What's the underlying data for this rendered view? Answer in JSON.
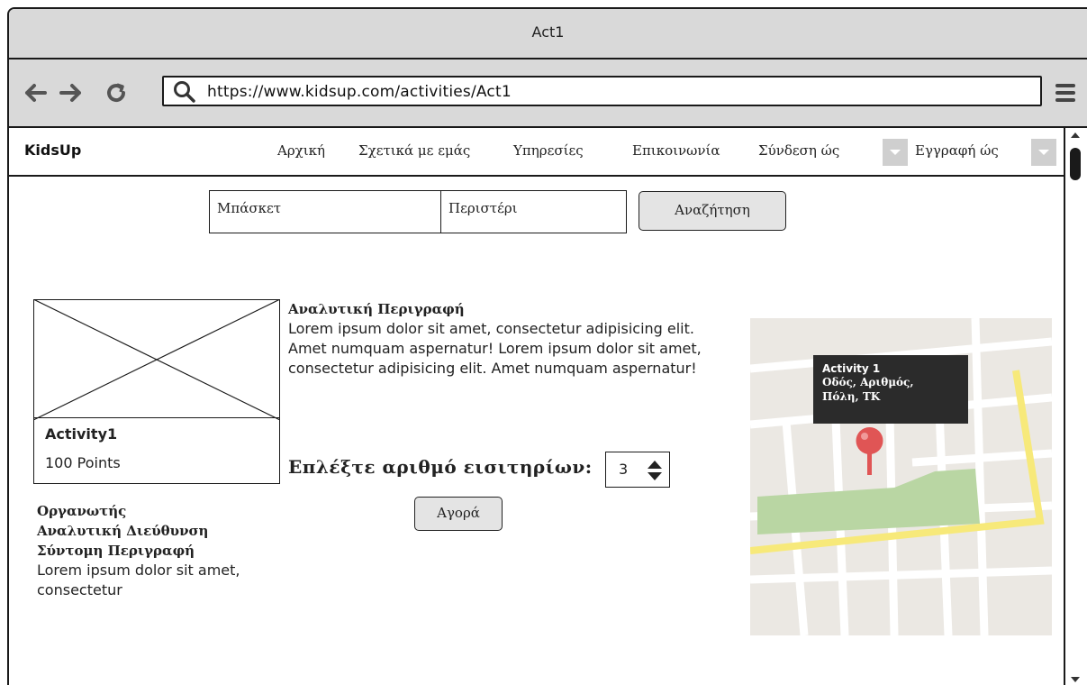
{
  "window": {
    "title": "Act1"
  },
  "browser": {
    "url": "https://www.kidsup.com/activities/Act1",
    "icons": [
      "back-arrow-icon",
      "forward-arrow-icon",
      "reload-icon",
      "search-icon",
      "hamburger-menu-icon"
    ]
  },
  "navbar": {
    "brand": "KidsUp",
    "items": [
      "Αρχική",
      "Σχετικά με εμάς",
      "Υπηρεσίες",
      "Επικοινωνία"
    ],
    "login_label": "Σύνδεση ώς",
    "register_label": "Εγγραφή ώς"
  },
  "search": {
    "activity": "Μπάσκετ",
    "location": "Περιστέρι",
    "button": "Αναζήτηση"
  },
  "activity": {
    "name": "Activity1",
    "points": "100 Points",
    "organizer_label": "Οργανωτής",
    "address_label": "Αναλυτική Διεύθυνση",
    "short_desc_label": "Σύντομη Περιγραφή",
    "short_desc": "Lorem ipsum dolor sit amet, consectetur"
  },
  "details": {
    "heading": "Αναλυτική Περιγραφή",
    "text": "Lorem ipsum dolor sit amet, consectetur adipisicing elit. Amet numquam aspernatur! Lorem ipsum dolor sit amet, consectetur adipisicing elit. Amet numquam aspernatur!",
    "tickets_label": "Επλέξτε αριθμό εισιτηρίων:",
    "tickets_value": "3",
    "buy_button": "Αγορά"
  },
  "map": {
    "tooltip_title": "Activity 1",
    "tooltip_address": "Οδός, Αριθμός, Πόλη, ΤΚ",
    "colors": {
      "road": "#f7e97a",
      "park": "#b9d6a3",
      "pin": "#e05555",
      "background": "#ebe8e3"
    }
  }
}
